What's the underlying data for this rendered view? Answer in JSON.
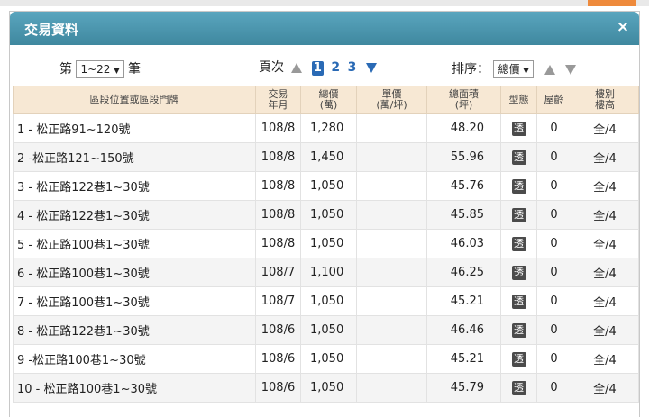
{
  "dialog": {
    "title": "交易資料",
    "close_symbol": "×"
  },
  "controls": {
    "range_prefix": "第",
    "range_value": "1~22",
    "range_suffix": "筆",
    "page_label": "頁次",
    "current_page": "1",
    "pages": [
      "2",
      "3"
    ],
    "sort_label": "排序：",
    "sort_value": "總價"
  },
  "table": {
    "headers": {
      "location": "區段位置或區段門牌",
      "date": [
        "交易",
        "年月"
      ],
      "total": [
        "總價",
        "(萬)"
      ],
      "unit": [
        "單價",
        "(萬/坪)"
      ],
      "area": [
        "總面積",
        "(坪)"
      ],
      "type": "型態",
      "age": "屋齡",
      "floor": [
        "樓別",
        "樓高"
      ]
    },
    "rows": [
      {
        "location": "1 - 松正路91~120號",
        "date": "108/8",
        "total": "1,280",
        "unit": "",
        "area": "48.20",
        "type": "透",
        "age": "0",
        "floor": "全/4"
      },
      {
        "location": "2 -松正路121~150號",
        "date": "108/8",
        "total": "1,450",
        "unit": "",
        "area": "55.96",
        "type": "透",
        "age": "0",
        "floor": "全/4"
      },
      {
        "location": "3 - 松正路122巷1~30號",
        "date": "108/8",
        "total": "1,050",
        "unit": "",
        "area": "45.76",
        "type": "透",
        "age": "0",
        "floor": "全/4"
      },
      {
        "location": "4 - 松正路122巷1~30號",
        "date": "108/8",
        "total": "1,050",
        "unit": "",
        "area": "45.85",
        "type": "透",
        "age": "0",
        "floor": "全/4"
      },
      {
        "location": "5 - 松正路100巷1~30號",
        "date": "108/8",
        "total": "1,050",
        "unit": "",
        "area": "46.03",
        "type": "透",
        "age": "0",
        "floor": "全/4"
      },
      {
        "location": "6 - 松正路100巷1~30號",
        "date": "108/7",
        "total": "1,100",
        "unit": "",
        "area": "46.25",
        "type": "透",
        "age": "0",
        "floor": "全/4"
      },
      {
        "location": "7 - 松正路100巷1~30號",
        "date": "108/7",
        "total": "1,050",
        "unit": "",
        "area": "45.21",
        "type": "透",
        "age": "0",
        "floor": "全/4"
      },
      {
        "location": "8 - 松正路122巷1~30號",
        "date": "108/6",
        "total": "1,050",
        "unit": "",
        "area": "46.46",
        "type": "透",
        "age": "0",
        "floor": "全/4"
      },
      {
        "location": "9 -松正路100巷1~30號",
        "date": "108/6",
        "total": "1,050",
        "unit": "",
        "area": "45.21",
        "type": "透",
        "age": "0",
        "floor": "全/4"
      },
      {
        "location": "10 - 松正路100巷1~30號",
        "date": "108/6",
        "total": "1,050",
        "unit": "",
        "area": "45.79",
        "type": "透",
        "age": "0",
        "floor": "全/4"
      }
    ]
  },
  "colors": {
    "titlebar": "#4a97af",
    "header_bg": "#f7e8d4",
    "pager_active": "#2a6ab5"
  }
}
